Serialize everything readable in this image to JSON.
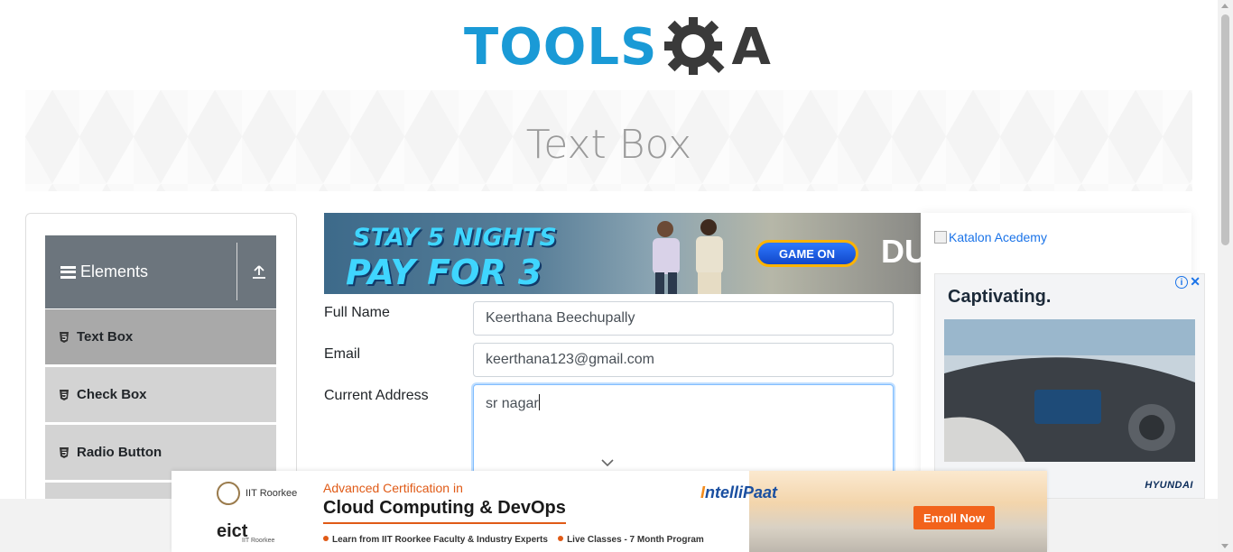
{
  "logo": {
    "left_text": "TOOLS",
    "right_text": "A"
  },
  "page_title": "Text Box",
  "sidebar": {
    "group_title": "Elements",
    "items": [
      {
        "label": "Text Box",
        "active": true
      },
      {
        "label": "Check Box",
        "active": false
      },
      {
        "label": "Radio Button",
        "active": false
      }
    ]
  },
  "top_ad": {
    "line1": "STAY 5 NIGHTS",
    "line2": "PAY FOR 3",
    "cta": "GAME ON",
    "brand": "DU"
  },
  "form": {
    "full_name": {
      "label": "Full Name",
      "value": "Keerthana Beechupally"
    },
    "email": {
      "label": "Email",
      "value": "keerthana123@gmail.com"
    },
    "current_address": {
      "label": "Current Address",
      "value": "sr nagar"
    }
  },
  "right_ads": {
    "katalon_alt": "Katalon Acedemy",
    "hyundai": {
      "slogan": "Captivating.",
      "brand": "HYUNDAI"
    }
  },
  "bottom_ad": {
    "partner1": "IIT Roorkee",
    "partner2": "eict",
    "partner2_sub": "IIT Roorkee",
    "kicker": "Advanced Certification in",
    "headline": "Cloud Computing & DevOps",
    "point1": "Learn from IIT Roorkee Faculty & Industry Experts",
    "point2": "Live Classes - 7 Month Program",
    "brand_accent": "I",
    "brand_rest": "ntelliPaat",
    "cta": "Enroll Now"
  }
}
